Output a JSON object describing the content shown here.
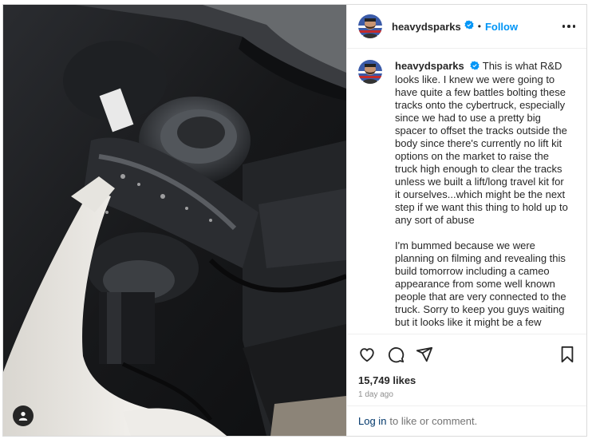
{
  "post": {
    "username": "heavydsparks",
    "follow_label": "Follow",
    "separator": "•",
    "caption": {
      "username": "heavydsparks",
      "paragraphs": [
        "This is what R&D looks like. I knew we were going to have quite a few battles bolting these tracks onto the cybertruck, especially since we had to use a pretty big spacer to offset the tracks outside the body since there's currently no lift kit options on the market to raise the truck high enough to clear the tracks unless we built a lift/long travel kit for it ourselves...which might be the next step if we want this thing to hold up to any sort of abuse",
        "I'm bummed because we were planning on filming and revealing this build tomorrow including a cameo appearance from some well known people that are very connected to the truck. Sorry to keep you guys waiting but it looks like it might be a few"
      ]
    },
    "likes": "15,749 likes",
    "time_ago": "1 day ago",
    "login": {
      "link_label": "Log in",
      "rest": "to like or comment."
    }
  },
  "icons": {
    "verified": "verified-badge-icon",
    "more": "more-options-icon",
    "like": "heart-icon",
    "comment": "comment-icon",
    "share": "share-icon",
    "save": "bookmark-icon",
    "tags": "user-tag-icon"
  },
  "colors": {
    "accent": "#0095f6",
    "verified": "#0095f6",
    "muted": "#8e8e8e",
    "link": "#00376b"
  }
}
